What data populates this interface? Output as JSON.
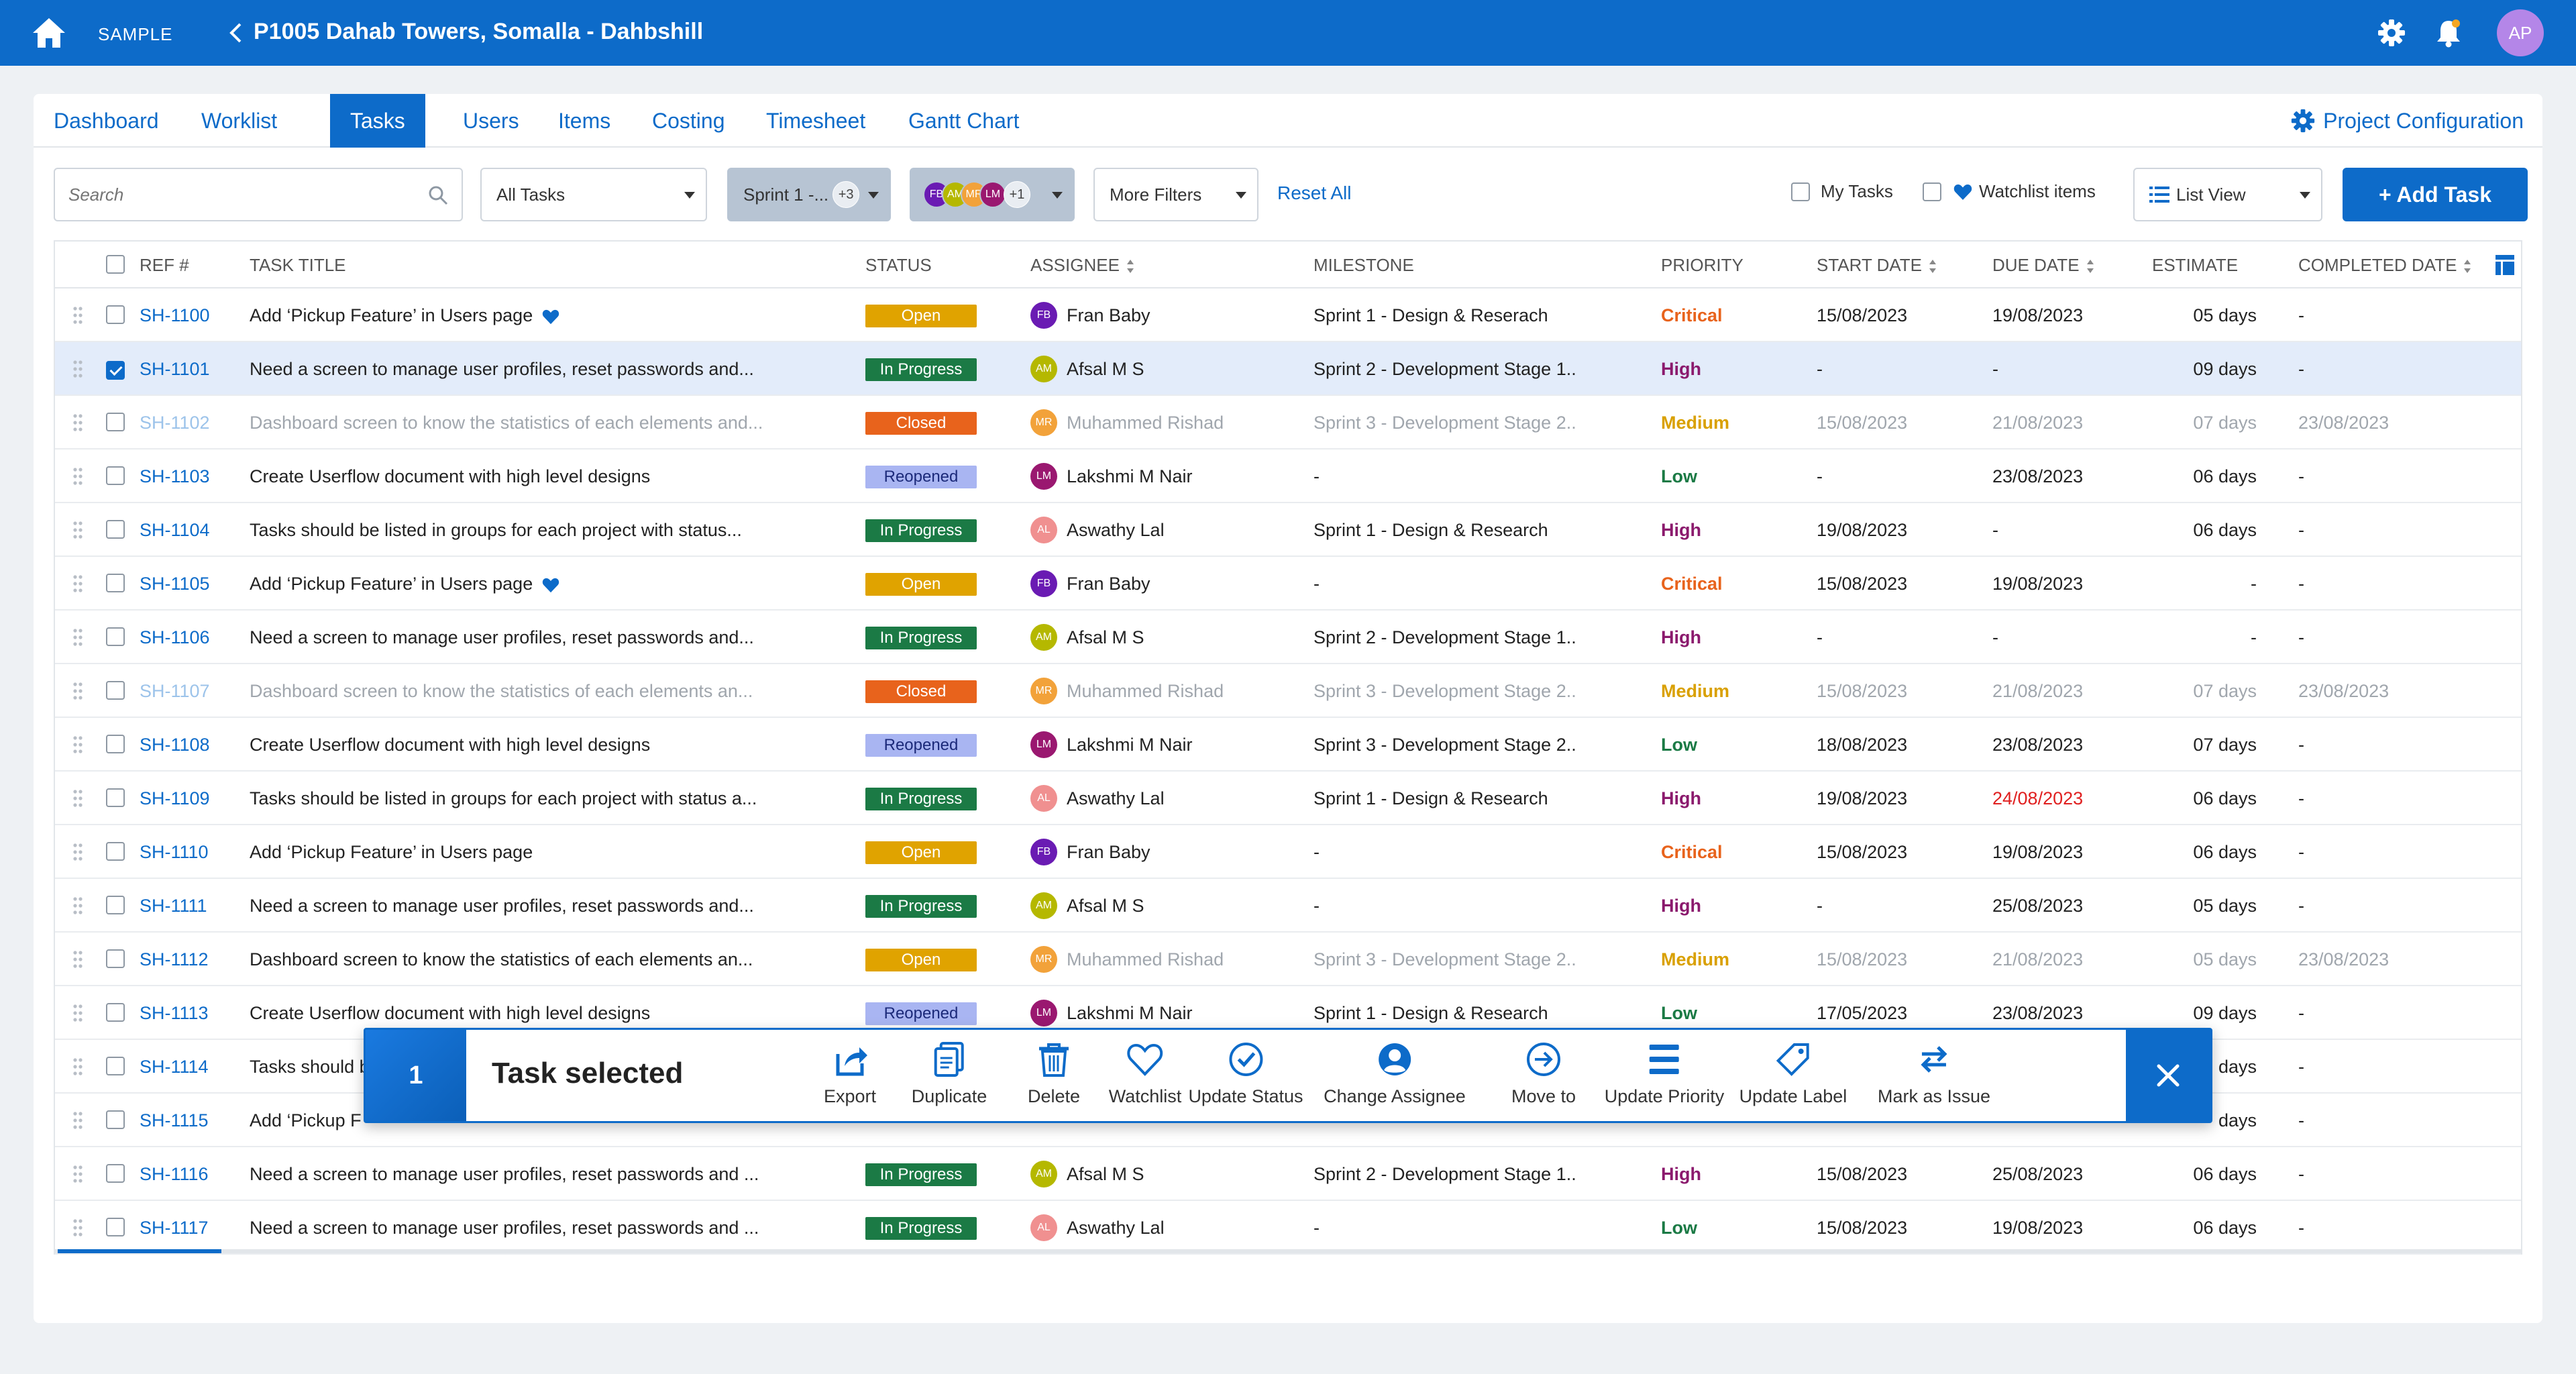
{
  "header": {
    "workspace": "SAMPLE",
    "project_title": "P1005 Dahab Towers, Somalla - Dahbshill",
    "user_initials": "AP"
  },
  "tabs": [
    {
      "label": "Dashboard"
    },
    {
      "label": "Worklist"
    },
    {
      "label": "Tasks",
      "active": true
    },
    {
      "label": "Users"
    },
    {
      "label": "Items"
    },
    {
      "label": "Costing"
    },
    {
      "label": "Timesheet"
    },
    {
      "label": "Gantt Chart"
    }
  ],
  "project_config_label": "Project Configuration",
  "filters": {
    "search_placeholder": "Search",
    "task_filter": "All Tasks",
    "sprint_filter": "Sprint 1 -...",
    "sprint_more": "+3",
    "assignee_avatars": [
      {
        "initials": "FB",
        "color": "#6a1bb3"
      },
      {
        "initials": "AM",
        "color": "#b5b800"
      },
      {
        "initials": "MR",
        "color": "#f2a23a"
      },
      {
        "initials": "LM",
        "color": "#9a1870"
      }
    ],
    "assignee_more": "+1",
    "more_filters": "More Filters",
    "reset_all": "Reset All",
    "my_tasks": "My Tasks",
    "watchlist_items": "Watchlist items",
    "view_mode": "List View",
    "add_task": "+ Add Task"
  },
  "columns": {
    "ref": "REF #",
    "title": "TASK TITLE",
    "status": "STATUS",
    "assignee": "ASSIGNEE",
    "milestone": "MILESTONE",
    "priority": "PRIORITY",
    "start_date": "START DATE",
    "due_date": "DUE DATE",
    "estimate": "ESTIMATE",
    "completed_date": "COMPLETED DATE"
  },
  "rows": [
    {
      "ref": "SH-1100",
      "title": "Add ‘Pickup Feature’ in Users page",
      "watch": true,
      "status": "Open",
      "assignee": "Fran Baby",
      "initials": "FB",
      "milestone": "Sprint 1 - Design & Reserach",
      "priority": "Critical",
      "start": "15/08/2023",
      "due": "19/08/2023",
      "estimate": "05 days",
      "completed": "-"
    },
    {
      "ref": "SH-1101",
      "title": "Need a screen to manage user profiles, reset passwords and...",
      "selected": true,
      "status": "In Progress",
      "assignee": "Afsal M S",
      "initials": "AM",
      "milestone": "Sprint 2 - Development Stage 1..",
      "priority": "High",
      "start": "-",
      "due": "-",
      "estimate": "09 days",
      "completed": "-"
    },
    {
      "ref": "SH-1102",
      "title": "Dashboard screen to know the statistics of each elements and...",
      "faded": true,
      "status": "Closed",
      "assignee": "Muhammed Rishad",
      "initials": "MR",
      "milestone": "Sprint 3 - Development Stage 2..",
      "priority": "Medium",
      "start": "15/08/2023",
      "due": "21/08/2023",
      "estimate": "07 days",
      "completed": "23/08/2023"
    },
    {
      "ref": "SH-1103",
      "title": "Create Userflow document with high level designs",
      "status": "Reopened",
      "assignee": "Lakshmi M Nair",
      "initials": "LM",
      "milestone": "-",
      "priority": "Low",
      "start": "-",
      "due": "23/08/2023",
      "estimate": "06 days",
      "completed": "-"
    },
    {
      "ref": "SH-1104",
      "title": "Tasks should be listed in groups for each project with status...",
      "status": "In Progress",
      "assignee": "Aswathy Lal",
      "initials": "AL",
      "milestone": "Sprint 1 - Design & Research",
      "priority": "High",
      "start": "19/08/2023",
      "due": "-",
      "estimate": "06 days",
      "completed": "-"
    },
    {
      "ref": "SH-1105",
      "title": "Add ‘Pickup Feature’ in Users page",
      "watch": true,
      "status": "Open",
      "assignee": "Fran Baby",
      "initials": "FB",
      "milestone": "-",
      "priority": "Critical",
      "start": "15/08/2023",
      "due": "19/08/2023",
      "estimate": "-",
      "completed": "-"
    },
    {
      "ref": "SH-1106",
      "title": "Need a screen to manage user profiles, reset passwords and...",
      "status": "In Progress",
      "assignee": "Afsal M S",
      "initials": "AM",
      "milestone": "Sprint 2 - Development Stage 1..",
      "priority": "High",
      "start": "-",
      "due": "-",
      "estimate": "-",
      "completed": "-"
    },
    {
      "ref": "SH-1107",
      "title": "Dashboard screen to know the statistics of each elements an...",
      "faded": true,
      "status": "Closed",
      "assignee": "Muhammed Rishad",
      "initials": "MR",
      "milestone": "Sprint 3 - Development Stage 2..",
      "priority": "Medium",
      "start": "15/08/2023",
      "due": "21/08/2023",
      "estimate": "07 days",
      "completed": "23/08/2023"
    },
    {
      "ref": "SH-1108",
      "title": "Create Userflow document with high level designs",
      "status": "Reopened",
      "assignee": "Lakshmi M Nair",
      "initials": "LM",
      "milestone": "Sprint 3 - Development Stage 2..",
      "priority": "Low",
      "start": "18/08/2023",
      "due": "23/08/2023",
      "estimate": "07 days",
      "completed": "-"
    },
    {
      "ref": "SH-1109",
      "title": "Tasks should be listed in groups for each project with status a...",
      "status": "In Progress",
      "assignee": "Aswathy Lal",
      "initials": "AL",
      "milestone": "Sprint 1 - Design & Research",
      "priority": "High",
      "start": "19/08/2023",
      "due": "24/08/2023",
      "overdue": true,
      "estimate": "06 days",
      "completed": "-"
    },
    {
      "ref": "SH-1110",
      "title": "Add ‘Pickup Feature’ in Users page",
      "status": "Open",
      "assignee": "Fran Baby",
      "initials": "FB",
      "milestone": "-",
      "priority": "Critical",
      "start": "15/08/2023",
      "due": "19/08/2023",
      "estimate": "06 days",
      "completed": "-"
    },
    {
      "ref": "SH-1111",
      "title": "Need a screen to manage user profiles, reset passwords and...",
      "status": "In Progress",
      "assignee": "Afsal M S",
      "initials": "AM",
      "milestone": "-",
      "priority": "High",
      "start": "-",
      "due": "25/08/2023",
      "estimate": "05 days",
      "completed": "-"
    },
    {
      "ref": "SH-1112",
      "title": "Dashboard screen to know the statistics of each elements an...",
      "status": "Open",
      "assignee": "Muhammed Rishad",
      "initials": "MR",
      "milestone": "Sprint 3 - Development Stage 2..",
      "priority": "Medium",
      "start": "15/08/2023",
      "due": "21/08/2023",
      "estimate": "05 days",
      "completed": "23/08/2023",
      "faded_right": true
    },
    {
      "ref": "SH-1113",
      "title": "Create Userflow document with high level designs",
      "status": "Reopened",
      "assignee": "Lakshmi M Nair",
      "initials": "LM",
      "milestone": "Sprint 1 - Design & Research",
      "priority": "Low",
      "start": "17/05/2023",
      "due": "23/08/2023",
      "estimate": "09 days",
      "completed": "-"
    },
    {
      "ref": "SH-1114",
      "title": "Tasks should b",
      "status": "",
      "assignee": "",
      "initials": "",
      "milestone": "",
      "priority": "",
      "start": "",
      "due": "",
      "estimate": "days",
      "completed": "-"
    },
    {
      "ref": "SH-1115",
      "title": "Add ‘Pickup F",
      "status": "",
      "assignee": "",
      "initials": "",
      "milestone": "",
      "priority": "",
      "start": "",
      "due": "",
      "estimate": "days",
      "completed": "-"
    },
    {
      "ref": "SH-1116",
      "title": "Need a screen to manage user profiles, reset passwords and ...",
      "status": "In Progress",
      "assignee": "Afsal M S",
      "initials": "AM",
      "milestone": "Sprint 2 - Development Stage 1..",
      "priority": "High",
      "start": "15/08/2023",
      "due": "25/08/2023",
      "estimate": "06 days",
      "completed": "-"
    },
    {
      "ref": "SH-1117",
      "title": "Need a screen to manage user profiles, reset passwords and ...",
      "status": "In Progress",
      "assignee": "Aswathy Lal",
      "initials": "AL",
      "milestone": "-",
      "priority": "Low",
      "start": "15/08/2023",
      "due": "19/08/2023",
      "estimate": "06 days",
      "completed": "-"
    }
  ],
  "avatar_colors": {
    "FB": "#6a1bb3",
    "AM": "#b5b800",
    "MR": "#f2a23a",
    "LM": "#9a1870",
    "AL": "#f09090"
  },
  "bulk_bar": {
    "count": "1",
    "label": "Task selected",
    "actions": [
      {
        "label": "Export",
        "icon": "export-icon"
      },
      {
        "label": "Duplicate",
        "icon": "duplicate-icon"
      },
      {
        "label": "Delete",
        "icon": "trash-icon"
      },
      {
        "label": "Watchlist",
        "icon": "heart-icon"
      },
      {
        "label": "Update Status",
        "icon": "check-circle-icon"
      },
      {
        "label": "Change Assignee",
        "icon": "user-circle-icon"
      },
      {
        "label": "Move to",
        "icon": "arrow-circle-icon"
      },
      {
        "label": "Update Priority",
        "icon": "priority-bars-icon"
      },
      {
        "label": "Update Label",
        "icon": "tag-icon"
      },
      {
        "label": "Mark as Issue",
        "icon": "swap-icon"
      }
    ]
  }
}
